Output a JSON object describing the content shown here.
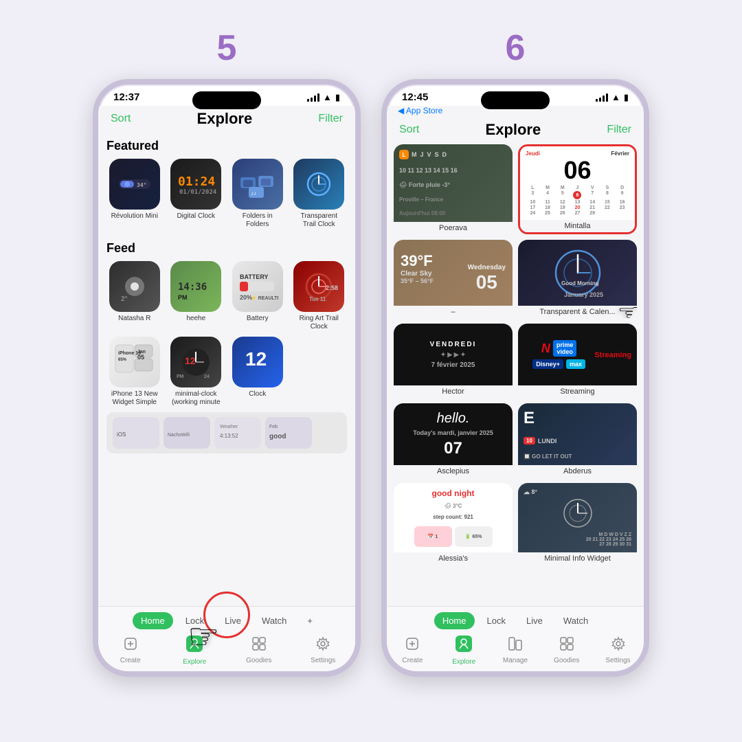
{
  "page": {
    "background_color": "#f0eef6",
    "step5": {
      "number": "5",
      "phone": {
        "time": "12:37",
        "header": {
          "sort": "Sort",
          "title": "Explore",
          "filter": "Filter"
        },
        "featured_title": "Featured",
        "featured_apps": [
          {
            "name": "Révolution Mini",
            "icon_class": "icon-revolution"
          },
          {
            "name": "Digital Clock",
            "icon_class": "icon-digital"
          },
          {
            "name": "Folders in Folders",
            "icon_class": "icon-folders"
          },
          {
            "name": "Transparent Trail Clock",
            "icon_class": "icon-transparent"
          }
        ],
        "feed_title": "Feed",
        "feed_apps_row1": [
          {
            "name": "Natasha R",
            "icon_class": "icon-natasha"
          },
          {
            "name": "heehe",
            "icon_class": "icon-heehe"
          },
          {
            "name": "Battery",
            "icon_class": "icon-battery"
          },
          {
            "name": "Ring Art Trail Clock",
            "icon_class": "icon-ring-art"
          }
        ],
        "feed_apps_row2": [
          {
            "name": "iPhone 13 New Widget Simple",
            "icon_class": "icon-iphone13"
          },
          {
            "name": "minimal-clock (working minute",
            "icon_class": "icon-minimal-clock"
          },
          {
            "name": "Clock",
            "icon_class": "icon-clock"
          },
          {
            "name": "",
            "icon_class": ""
          }
        ],
        "widget_tabs": [
          "Home",
          "Lock",
          "Live",
          "Watch"
        ],
        "active_widget_tab": "Home",
        "nav_items": [
          {
            "label": "Create",
            "icon": "＋"
          },
          {
            "label": "Explore",
            "icon": "◈",
            "active": true
          },
          {
            "label": "Goodies",
            "icon": "⊞"
          },
          {
            "label": "Settings",
            "icon": "⚙"
          }
        ],
        "bottom_note": "+"
      }
    },
    "step6": {
      "number": "6",
      "phone": {
        "time": "12:45",
        "back_label": "◀ App Store",
        "header": {
          "sort": "Sort",
          "title": "Explore",
          "filter": "Filter"
        },
        "widgets": [
          {
            "label": "Poerava",
            "type": "poerava"
          },
          {
            "label": "Mintalla",
            "type": "mintalla",
            "highlighted": true
          },
          {
            "label": "–",
            "type": "weather"
          },
          {
            "label": "Transparent & Calen...",
            "type": "transparent"
          },
          {
            "label": "Hector",
            "type": "hector"
          },
          {
            "label": "Streaming",
            "type": "streaming"
          },
          {
            "label": "Asclepius",
            "type": "asclepius"
          },
          {
            "label": "Abderus",
            "type": "abderus"
          },
          {
            "label": "Alessia's",
            "type": "alessias"
          },
          {
            "label": "Minimal Info Widget",
            "type": "minimal"
          }
        ],
        "widget_tabs": [
          "Home",
          "Lock",
          "Live",
          "Watch"
        ],
        "active_widget_tab": "Home",
        "nav_items": [
          {
            "label": "Create",
            "icon": "＋"
          },
          {
            "label": "Explore",
            "icon": "◈",
            "active": true
          },
          {
            "label": "Manage",
            "icon": "⊟"
          },
          {
            "label": "Goodies",
            "icon": "⊞"
          },
          {
            "label": "Settings",
            "icon": "⚙"
          }
        ]
      }
    }
  }
}
